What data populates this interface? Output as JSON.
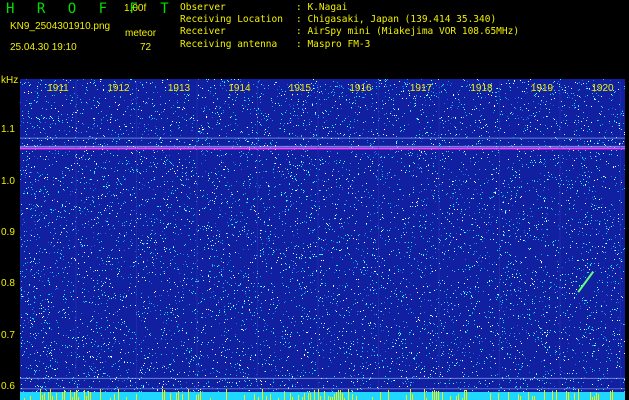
{
  "header": {
    "app_title": "H R O F F T",
    "version": "1.00f",
    "file_name": "KN9_2504301910.png",
    "datetime": "25.04.30 19:10",
    "meteor_label": "meteor",
    "meteor_count": "72"
  },
  "info": [
    {
      "label": "Observer",
      "value": ": K.Nagai"
    },
    {
      "label": "Receiving Location",
      "value": ": Chigasaki, Japan (139.414 35.340)"
    },
    {
      "label": "Receiver",
      "value": ": AirSpy mini (Miakejima VOR 108.65MHz)"
    },
    {
      "label": "Receiving antenna",
      "value": ": Maspro FM-3"
    }
  ],
  "chart_data": {
    "type": "heatmap",
    "ylabel": "kHz",
    "y_ticks": [
      "1.1",
      "1.0",
      "0.9",
      "0.8",
      "0.7",
      "0.6"
    ],
    "x_ticks": [
      "1911",
      "1912",
      "1913",
      "1914",
      "1915",
      "1916",
      "1917",
      "1918",
      "1919",
      "1920"
    ],
    "ylim": [
      0.575,
      1.2
    ],
    "carrier_khz": 1.065,
    "meteor_trace": {
      "x_start": "1919.3",
      "x_end": "1919.55",
      "y_start_khz": 0.785,
      "y_end_khz": 0.825
    },
    "colors": {
      "background": "#1020a0",
      "noise": "#00ffff",
      "carrier": "#ff40ff",
      "axis_text": "#f0f000"
    }
  }
}
